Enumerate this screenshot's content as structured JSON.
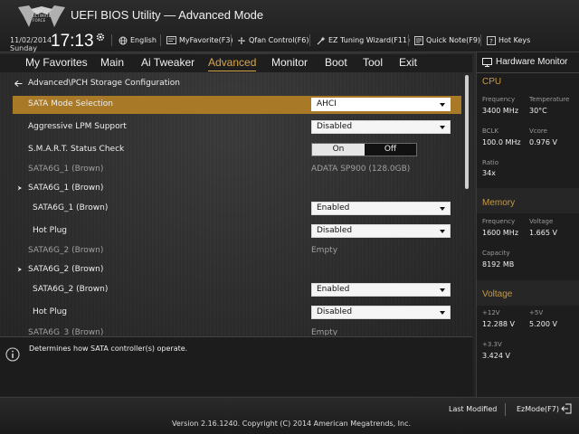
{
  "header": {
    "logo_text": [
      "THE",
      "ULTIMATE",
      "FORCE"
    ],
    "title": "UEFI BIOS Utility — Advanced Mode",
    "date": "11/02/2014",
    "day": "Sunday",
    "time": "17:13",
    "tools": [
      {
        "label": "English",
        "icon": "globe-icon"
      },
      {
        "label": "MyFavorite(F3)",
        "icon": "favorite-icon"
      },
      {
        "label": "Qfan Control(F6)",
        "icon": "fan-icon"
      },
      {
        "label": "EZ Tuning Wizard(F11)",
        "icon": "wizard-icon"
      },
      {
        "label": "Quick Note(F9)",
        "icon": "note-icon"
      },
      {
        "label": "Hot Keys",
        "icon": "hotkeys-icon"
      }
    ]
  },
  "menu": {
    "items": [
      "My Favorites",
      "Main",
      "Ai Tweaker",
      "Advanced",
      "Monitor",
      "Boot",
      "Tool",
      "Exit"
    ],
    "active": "Advanced"
  },
  "main": {
    "breadcrumb": "Advanced\\PCH Storage Configuration",
    "rows": {
      "sata_mode": {
        "label": "SATA Mode Selection",
        "value": "AHCI"
      },
      "lpm": {
        "label": "Aggressive LPM Support",
        "value": "Disabled"
      },
      "smart": {
        "label": "S.M.A.R.T. Status Check",
        "on": "On",
        "off": "Off"
      },
      "port1_info": {
        "label": "SATA6G_1 (Brown)",
        "value": "ADATA SP900 (128.0GB)"
      },
      "port1_group": {
        "label": "SATA6G_1 (Brown)"
      },
      "port1_enable": {
        "label": "SATA6G_1 (Brown)",
        "value": "Enabled"
      },
      "port1_hotplug": {
        "label": "Hot Plug",
        "value": "Disabled"
      },
      "port2_info": {
        "label": "SATA6G_2 (Brown)",
        "value": "Empty"
      },
      "port2_group": {
        "label": "SATA6G_2 (Brown)"
      },
      "port2_enable": {
        "label": "SATA6G_2 (Brown)",
        "value": "Enabled"
      },
      "port2_hotplug": {
        "label": "Hot Plug",
        "value": "Disabled"
      },
      "port3_info": {
        "label": "SATA6G_3 (Brown)",
        "value": "Empty"
      }
    }
  },
  "help": {
    "text": "Determines how SATA controller(s) operate."
  },
  "hwm": {
    "title": "Hardware Monitor",
    "cpu": {
      "section": "CPU",
      "frequency_label": "Frequency",
      "frequency": "3400 MHz",
      "temperature_label": "Temperature",
      "temperature": "30°C",
      "bclk_label": "BCLK",
      "bclk": "100.0 MHz",
      "vcore_label": "Vcore",
      "vcore": "0.976 V",
      "ratio_label": "Ratio",
      "ratio": "34x"
    },
    "memory": {
      "section": "Memory",
      "frequency_label": "Frequency",
      "frequency": "1600 MHz",
      "voltage_label": "Voltage",
      "voltage": "1.665 V",
      "capacity_label": "Capacity",
      "capacity": "8192 MB"
    },
    "voltage": {
      "section": "Voltage",
      "v12_label": "+12V",
      "v12": "12.288 V",
      "v5_label": "+5V",
      "v5": "5.200 V",
      "v33_label": "+3.3V",
      "v33": "3.424 V"
    }
  },
  "footer": {
    "version": "Version 2.16.1240. Copyright (C) 2014 American Megatrends, Inc.",
    "last_modified": "Last Modified",
    "ezmode": "EzMode(F7)"
  },
  "colors": {
    "accent": "#d8a64a",
    "selected_row": "#a87a28",
    "section_heading": "#c79a45"
  }
}
